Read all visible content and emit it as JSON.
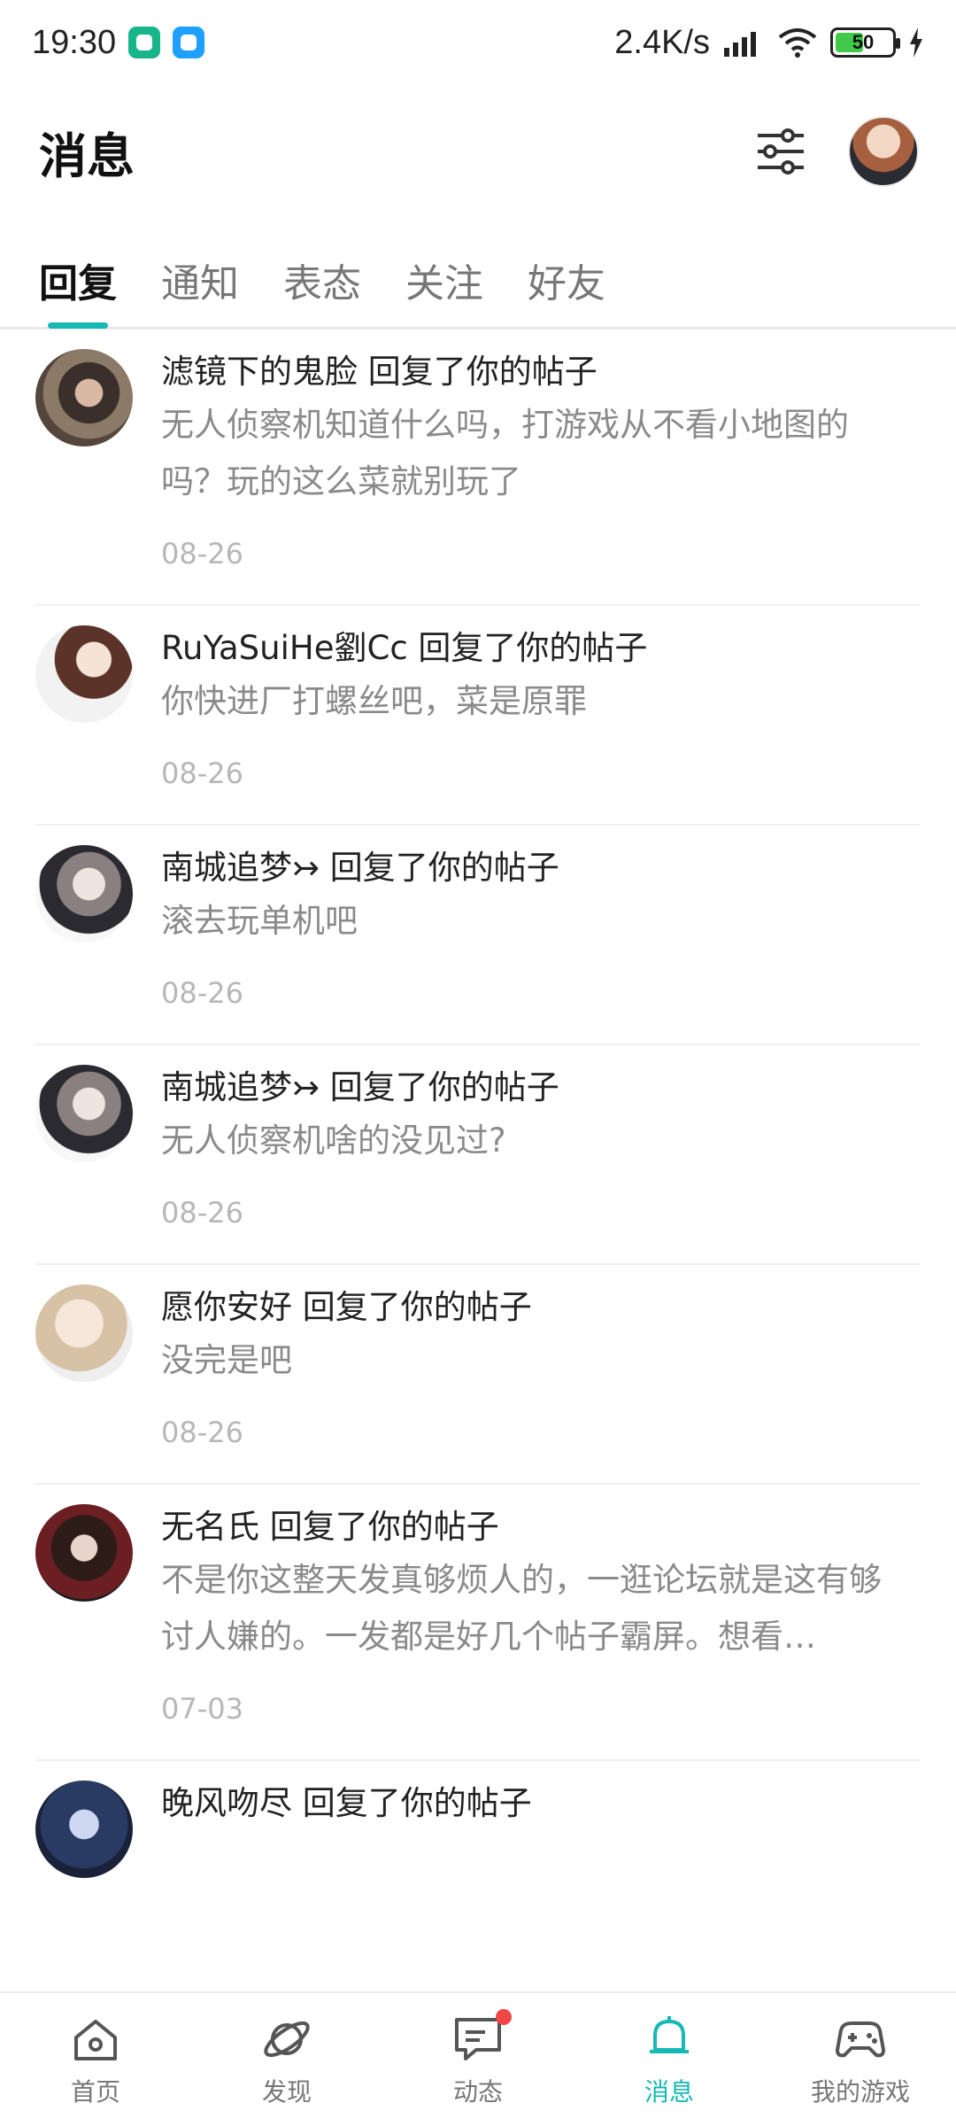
{
  "status_bar": {
    "time": "19:30",
    "network_speed": "2.4K/s",
    "battery": "50"
  },
  "header": {
    "title": "消息"
  },
  "tabs": [
    {
      "label": "回复",
      "active": true
    },
    {
      "label": "通知",
      "active": false
    },
    {
      "label": "表态",
      "active": false
    },
    {
      "label": "关注",
      "active": false
    },
    {
      "label": "好友",
      "active": false
    }
  ],
  "messages": [
    {
      "title": "滤镜下的鬼脸 回复了你的帖子",
      "text": "无人侦察机知道什么吗，打游戏从不看小地图的吗？玩的这么菜就别玩了",
      "time": "08-26"
    },
    {
      "title": "RuYaSuiHe劉Cc 回复了你的帖子",
      "text": "你快进厂打螺丝吧，菜是原罪",
      "time": "08-26"
    },
    {
      "title": "南城追梦↣ 回复了你的帖子",
      "text": "滚去玩单机吧",
      "time": "08-26"
    },
    {
      "title": "南城追梦↣ 回复了你的帖子",
      "text": "无人侦察机啥的没见过?",
      "time": "08-26"
    },
    {
      "title": "愿你安好 回复了你的帖子",
      "text": "没完是吧",
      "time": "08-26"
    },
    {
      "title": "无名氏 回复了你的帖子",
      "text": "不是你这整天发真够烦人的，一逛论坛就是这有够讨人嫌的。一发都是好几个帖子霸屏。想看…",
      "time": "07-03"
    },
    {
      "title": "晚风吻尽 回复了你的帖子",
      "text": "",
      "time": ""
    }
  ],
  "bottom_nav": [
    {
      "label": "首页",
      "icon": "home-icon"
    },
    {
      "label": "发现",
      "icon": "planet-icon"
    },
    {
      "label": "动态",
      "icon": "chat-icon"
    },
    {
      "label": "消息",
      "icon": "bell-icon",
      "active": true
    },
    {
      "label": "我的游戏",
      "icon": "gamepad-icon"
    }
  ],
  "colors": {
    "accent": "#16b9b4",
    "notification_dot": "#f04646"
  }
}
